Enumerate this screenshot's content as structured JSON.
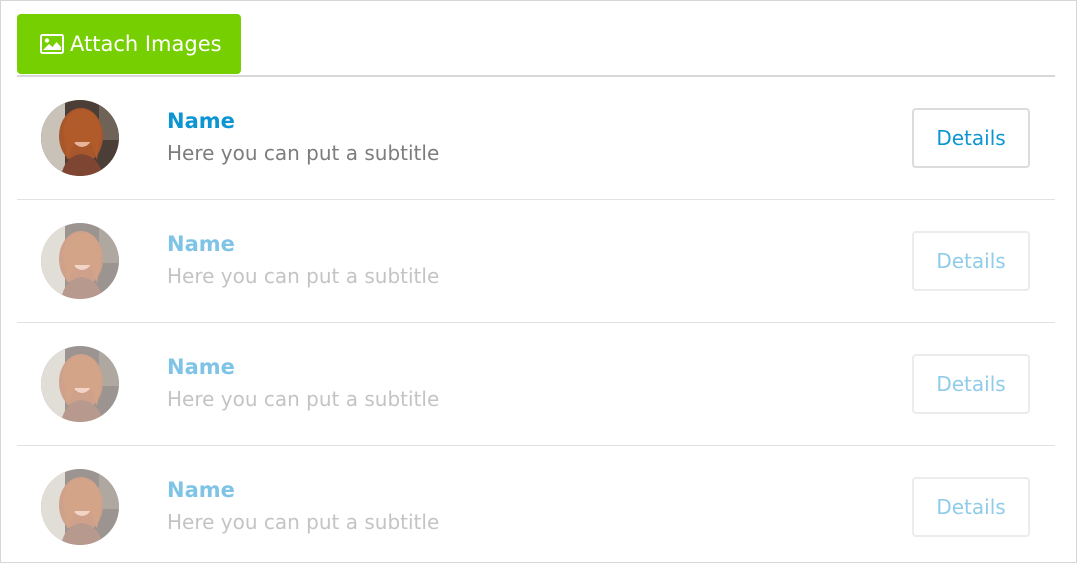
{
  "toolbar": {
    "attach_label": "Attach Images",
    "attach_icon": "image-icon",
    "attach_color": "#76cf00"
  },
  "accent_color": "#0d95d3",
  "items": [
    {
      "name": "Name",
      "subtitle": "Here you can put a subtitle",
      "button": "Details",
      "state": "active"
    },
    {
      "name": "Name",
      "subtitle": "Here you can put a subtitle",
      "button": "Details",
      "state": "faded"
    },
    {
      "name": "Name",
      "subtitle": "Here you can put a subtitle",
      "button": "Details",
      "state": "faded"
    },
    {
      "name": "Name",
      "subtitle": "Here you can put a subtitle",
      "button": "Details",
      "state": "faded"
    }
  ]
}
